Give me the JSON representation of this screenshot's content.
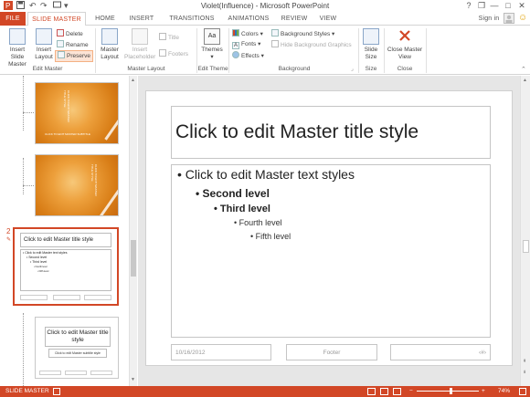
{
  "window": {
    "title": "Violet(Influence) - Microsoft PowerPoint",
    "controls": {
      "help": "?",
      "restore": "❐",
      "minimize": "—",
      "maximize": "□",
      "close": "✕"
    }
  },
  "qat": {
    "save_icon": "save-icon",
    "undo": "↶",
    "redo": "↷",
    "customize": "▾"
  },
  "tabs": [
    {
      "label": "FILE"
    },
    {
      "label": "SLIDE MASTER"
    },
    {
      "label": "HOME"
    },
    {
      "label": "INSERT"
    },
    {
      "label": "TRANSITIONS"
    },
    {
      "label": "ANIMATIONS"
    },
    {
      "label": "REVIEW"
    },
    {
      "label": "VIEW"
    }
  ],
  "account": {
    "sign_in": "Sign in",
    "smiley": "☺"
  },
  "ribbon": {
    "edit_master": {
      "label": "Edit Master",
      "insert_slide_master": "Insert Slide Master",
      "insert_layout": "Insert Layout",
      "delete": "Delete",
      "rename": "Rename",
      "preserve": "Preserve"
    },
    "master_layout": {
      "label": "Master Layout",
      "master_layout": "Master Layout",
      "insert_placeholder": "Insert Placeholder",
      "title_check": "Title",
      "footers_check": "Footers"
    },
    "edit_theme": {
      "label": "Edit Theme",
      "themes": "Themes"
    },
    "background": {
      "label": "Background",
      "colors": "Colors",
      "fonts": "Fonts",
      "effects": "Effects",
      "background_styles": "Background Styles",
      "hide_background_graphics": "Hide Background Graphics"
    },
    "size": {
      "label": "Size",
      "slide_size": "Slide Size"
    },
    "close": {
      "label": "Close",
      "close_master_view": "Close Master View"
    }
  },
  "thumbnails": {
    "slide_number": "2",
    "orange1": {
      "text": "CLICK TO EDIT MASTER TITLE STYLE",
      "footer": "CLICK TO EDIT MASTER SUBTITLE"
    },
    "orange2": {
      "text": "CLICK TO EDIT MASTER TITLE STYLE"
    },
    "selected": {
      "title": "Click to edit Master title style",
      "bullets": [
        "• Click to edit Master text styles",
        "• Second level",
        "• Third level",
        "• Fourth level",
        "• Fifth level"
      ]
    },
    "last": {
      "title": "Click to edit Master title style",
      "subtitle": "Click to edit Master subtitle style"
    }
  },
  "slide": {
    "title": "Click to edit Master title style",
    "levels": [
      "Click to edit Master text styles",
      "Second level",
      "Third level",
      "Fourth level",
      "Fifth level"
    ],
    "date": "10/16/2012",
    "footer": "Footer",
    "slide_number": "‹#›"
  },
  "statusbar": {
    "mode": "SLIDE MASTER",
    "zoom": "74%",
    "zoom_minus": "−",
    "zoom_plus": "+"
  },
  "colors": {
    "accent": "#d24726",
    "tab_text": "#555555"
  }
}
